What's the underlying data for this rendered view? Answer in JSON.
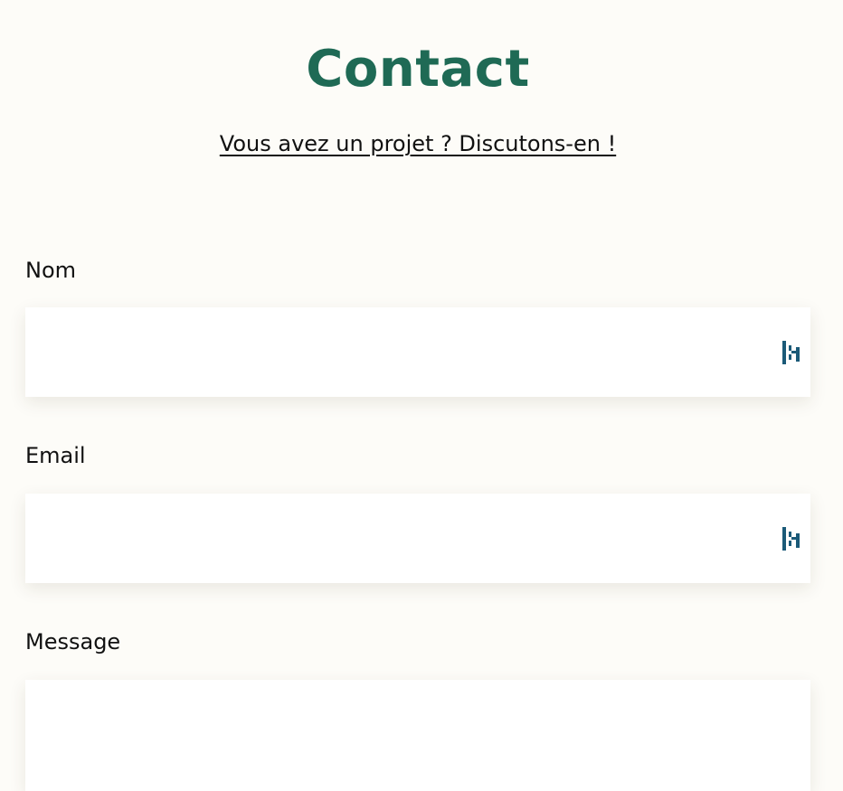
{
  "page": {
    "title": "Contact",
    "subtitle_link": "Vous avez un projet ? Discutons-en !"
  },
  "form": {
    "name": {
      "label": "Nom",
      "value": "",
      "placeholder": ""
    },
    "email": {
      "label": "Email",
      "value": "",
      "placeholder": ""
    },
    "message": {
      "label": "Message",
      "value": "",
      "placeholder": ""
    }
  },
  "icons": {
    "password_manager": "password-manager-icon"
  },
  "colors": {
    "title": "#1f6a55",
    "icon": "#1b5a78",
    "background": "#fdfcf8"
  }
}
